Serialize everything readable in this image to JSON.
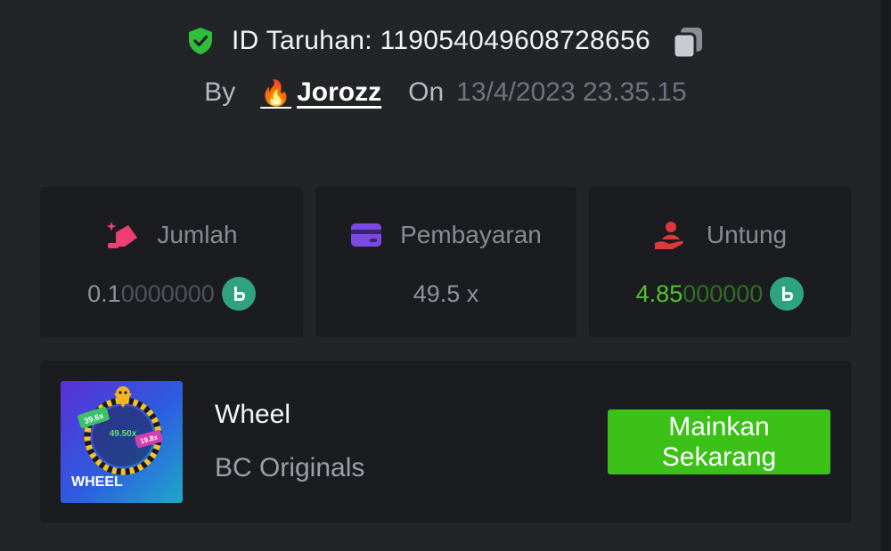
{
  "header": {
    "bet_id_label": "ID Taruhan: 119054049608728656",
    "by_label": "By",
    "username": "Jorozz",
    "on_label": "On",
    "date": "13/4/2023 23.35.15"
  },
  "stats": [
    {
      "label": "Jumlah",
      "value_strong": "0.1",
      "value_faint": "0000000",
      "icon": "bet-amount-icon",
      "coin": "bc-coin-icon"
    },
    {
      "label": "Pembayaran",
      "value": "49.5 x",
      "icon": "card-icon"
    },
    {
      "label": "Untung",
      "value_strong": "4.85",
      "value_faint": "000000",
      "icon": "profit-hand-icon",
      "coin": "bc-coin-icon"
    }
  ],
  "game": {
    "thumbnail_text": "WHEEL",
    "thumbnail_multipliers": [
      "39.6x",
      "49.50x",
      "19.8x"
    ],
    "name": "Wheel",
    "provider": "BC Originals",
    "play_label": "Mainkan Sekarang"
  },
  "colors": {
    "background": "#232428",
    "card": "#1b1c1f",
    "accent_green": "#3bc117",
    "profit_green": "#56c02d",
    "coin": "#2fa37e"
  }
}
